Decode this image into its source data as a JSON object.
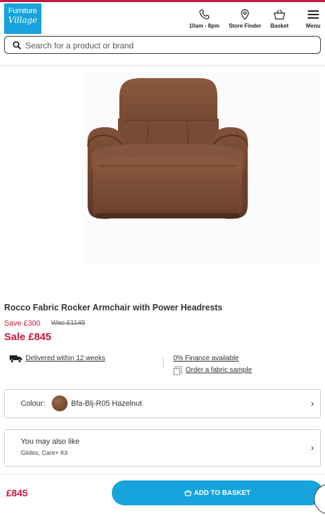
{
  "brand": {
    "logo_line1": "Furniture",
    "logo_line2": "Village",
    "accent_color": "#c8173c",
    "primary_color": "#17a3dc"
  },
  "header": {
    "hours": {
      "label": "10am - 8pm",
      "icon": "phone-icon"
    },
    "store_finder": {
      "label": "Store Finder",
      "icon": "map-pin-icon"
    },
    "basket": {
      "label": "Basket",
      "icon": "basket-icon"
    },
    "menu": {
      "label": "Menu",
      "icon": "hamburger-icon"
    }
  },
  "search": {
    "placeholder": "Search for a product or brand",
    "value": "",
    "icon": "search-icon"
  },
  "product": {
    "title": "Rocco Fabric Rocker Armchair with Power Headrests",
    "save": "Save £300",
    "was": "Was £1145",
    "sale_price": "Sale £845",
    "image_desc_color": "#7a4a33"
  },
  "info": {
    "delivery": "Delivered within 12 weeks",
    "finance": "0% Finance available",
    "sample": "Order a fabric sample"
  },
  "colour": {
    "label": "Colour:",
    "value": "Bfa-Blj-R05 Hazelnut",
    "swatch_color": "#7a4c31"
  },
  "also_like": {
    "title": "You may also like",
    "subtitle": "Glides, Care+ Kit"
  },
  "bottom_bar": {
    "price": "£845",
    "add_button": "ADD TO BASKET"
  }
}
